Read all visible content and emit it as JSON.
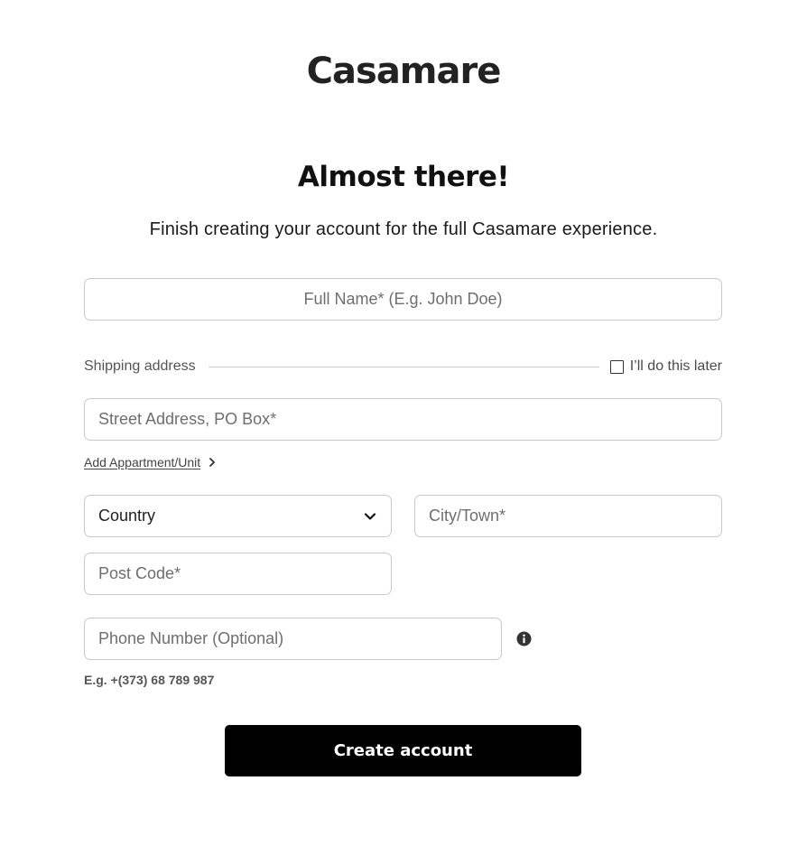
{
  "brand": {
    "logo_text": "Casamare"
  },
  "header": {
    "title": "Almost there!",
    "subtitle": "Finish creating your account for the full Casamare experience."
  },
  "form": {
    "full_name": {
      "placeholder": "Full Name* (E.g. John Doe)",
      "value": ""
    },
    "shipping_section": {
      "label": "Shipping address",
      "later_checkbox_label": "I’ll do this later",
      "later_checked": false
    },
    "street": {
      "placeholder": "Street Address, PO Box*",
      "value": ""
    },
    "add_unit_link": "Add Appartment/Unit",
    "country": {
      "selected": "Country"
    },
    "city": {
      "placeholder": "City/Town*",
      "value": ""
    },
    "post_code": {
      "placeholder": "Post Code*",
      "value": ""
    },
    "phone": {
      "placeholder": "Phone Number (Optional)",
      "value": ""
    },
    "phone_hint": "E.g. +(373) 68 789 987",
    "submit_label": "Create account"
  },
  "icons": {
    "country_dropdown": "chevron-down-icon",
    "add_unit": "chevron-right-icon",
    "phone_info": "info-icon"
  },
  "colors": {
    "button_bg": "#000000",
    "button_text": "#ffffff",
    "border": "#c9c9c9"
  }
}
